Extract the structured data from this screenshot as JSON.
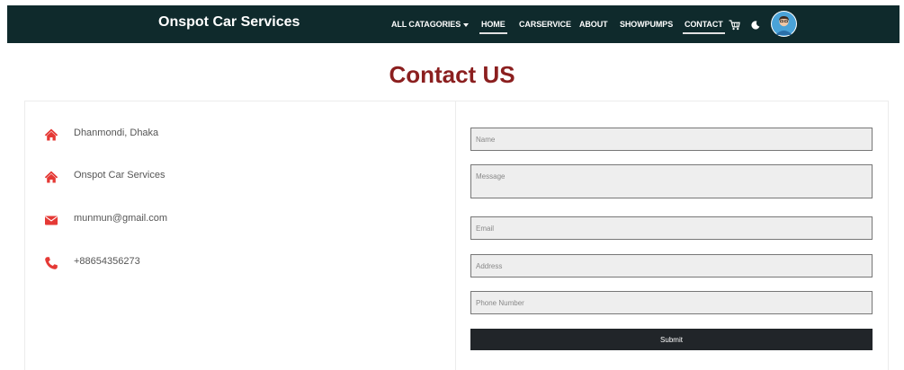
{
  "navbar": {
    "brand": "Onspot Car Services",
    "links": [
      {
        "label": "ALL CATAGORIES",
        "has_dropdown": true
      },
      {
        "label": "HOME",
        "active": true
      },
      {
        "label": "CARSERVICE"
      },
      {
        "label": "ABOUT"
      },
      {
        "label": "SHOWPUMPS"
      },
      {
        "label": "CONTACT",
        "active": true
      }
    ],
    "icons": [
      "cart-icon",
      "moon-icon",
      "user-avatar"
    ],
    "background": "#0f2a2c"
  },
  "page": {
    "title": "Contact US",
    "title_color": "#8b1f1f"
  },
  "contact_info": [
    {
      "icon": "home-icon",
      "text": "Dhanmondi, Dhaka"
    },
    {
      "icon": "home-icon",
      "text": "Onspot Car Services"
    },
    {
      "icon": "envelope-icon",
      "text": "munmun@gmail.com"
    },
    {
      "icon": "phone-icon",
      "text": "+88654356273"
    }
  ],
  "icon_color": "#e53935",
  "form": {
    "name_placeholder": "Name",
    "message_placeholder": "Message",
    "email_placeholder": "Email",
    "address_placeholder": "Address",
    "phone_placeholder": "Phone Number",
    "submit_label": "Submit"
  }
}
